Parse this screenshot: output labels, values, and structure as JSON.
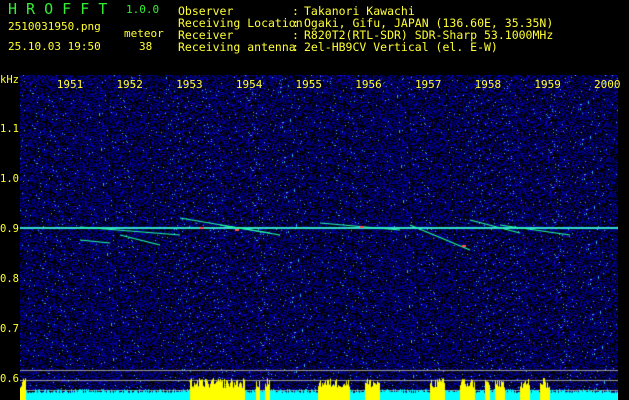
{
  "app": {
    "name": "H R O F F T",
    "version": "1.0.0"
  },
  "file": {
    "name": "2510031950.png",
    "datetime": "25.10.03 19:50"
  },
  "count": {
    "label": "meteor",
    "value": "38"
  },
  "info": [
    {
      "label": "Observer",
      "value": "Takanori Kawachi"
    },
    {
      "label": "Receiving Location",
      "value": "Ogaki, Gifu, JAPAN (136.60E, 35.35N)"
    },
    {
      "label": "Receiver",
      "value": "R820T2(RTL-SDR) SDR-Sharp 53.1000MHz"
    },
    {
      "label": "Receiving antenna",
      "value": "2el-HB9CV Vertical (el. E-W)"
    }
  ],
  "separator": ":",
  "axis": {
    "y_unit": "kHz",
    "y_ticks": [
      "1.1",
      "1.0",
      "0.9",
      "0.8",
      "0.7",
      "0.6"
    ],
    "x_ticks": [
      "1951",
      "1952",
      "1953",
      "1954",
      "1955",
      "1956",
      "1957",
      "1958",
      "1959",
      "2000"
    ]
  },
  "colors": {
    "text": "#ffff33",
    "title": "#33ee33",
    "background": "#000000",
    "noise": "#1a1aa0",
    "carrier": "#33ffcc",
    "bars_low": "#00ffff",
    "bars_high": "#ffff00"
  }
}
